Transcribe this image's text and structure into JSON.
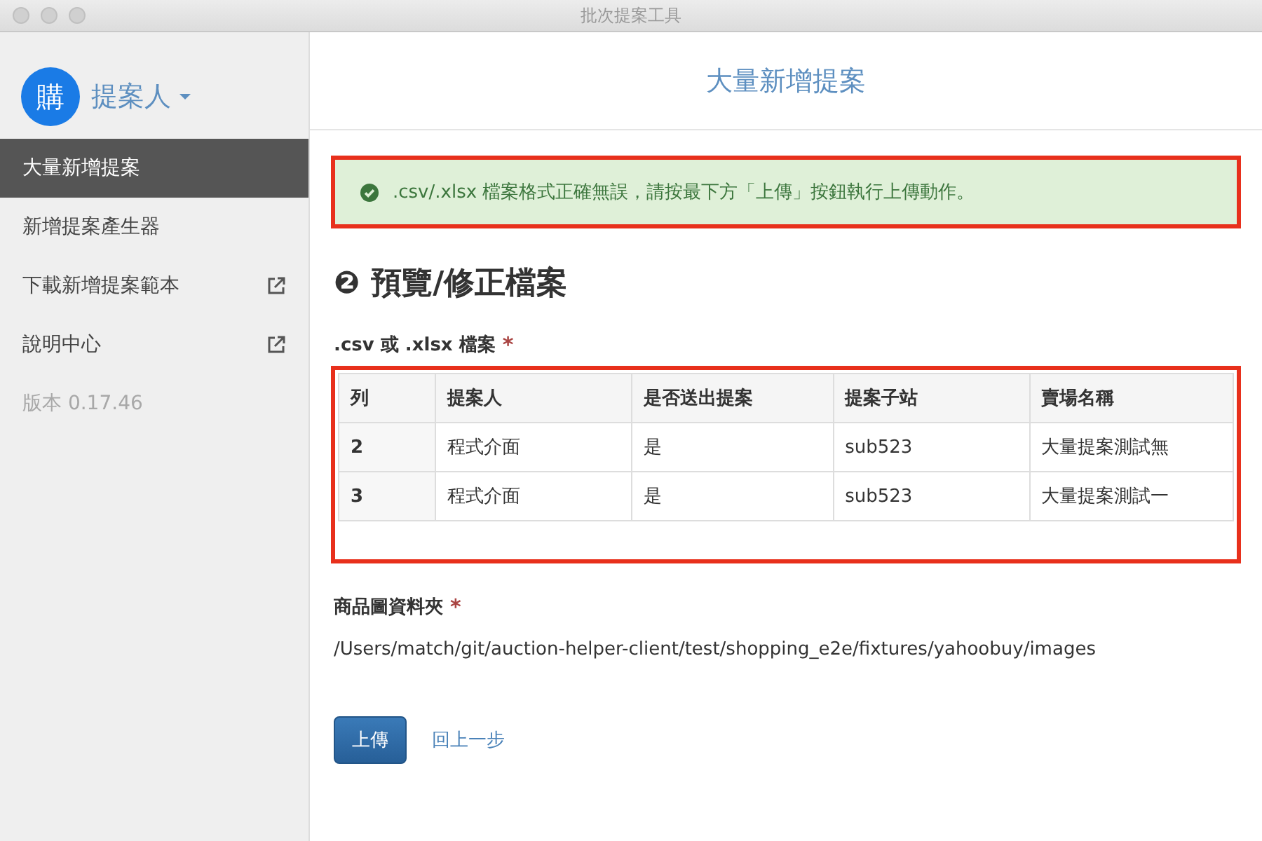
{
  "window": {
    "title": "批次提案工具"
  },
  "sidebar": {
    "avatar": "購",
    "user": "提案人",
    "items": [
      {
        "label": "大量新增提案",
        "selected": true,
        "external": false
      },
      {
        "label": "新增提案產生器",
        "selected": false,
        "external": false
      },
      {
        "label": "下載新增提案範本",
        "selected": false,
        "external": true
      },
      {
        "label": "說明中心",
        "selected": false,
        "external": true
      }
    ],
    "version": "版本 0.17.46"
  },
  "header": {
    "title": "大量新增提案"
  },
  "alert": {
    "text": ".csv/.xlsx 檔案格式正確無誤，請按最下方「上傳」按鈕執行上傳動作。",
    "highlighted": true
  },
  "section": {
    "step": "❷",
    "title": "預覽/修正檔案"
  },
  "file_field": {
    "label": ".csv 或 .xlsx 檔案",
    "required_mark": "*"
  },
  "table": {
    "highlighted": true,
    "columns": [
      "列",
      "提案人",
      "是否送出提案",
      "提案子站",
      "賣場名稱"
    ],
    "rows": [
      [
        "2",
        "程式介面",
        "是",
        "sub523",
        "大量提案測試無"
      ],
      [
        "3",
        "程式介面",
        "是",
        "sub523",
        "大量提案測試一"
      ]
    ]
  },
  "folder_field": {
    "label": "商品圖資料夾",
    "required_mark": "*",
    "value": "/Users/match/git/auction-helper-client/test/shopping_e2e/fixtures/yahoobuy/images"
  },
  "buttons": {
    "upload": "上傳",
    "back": "回上一步"
  }
}
